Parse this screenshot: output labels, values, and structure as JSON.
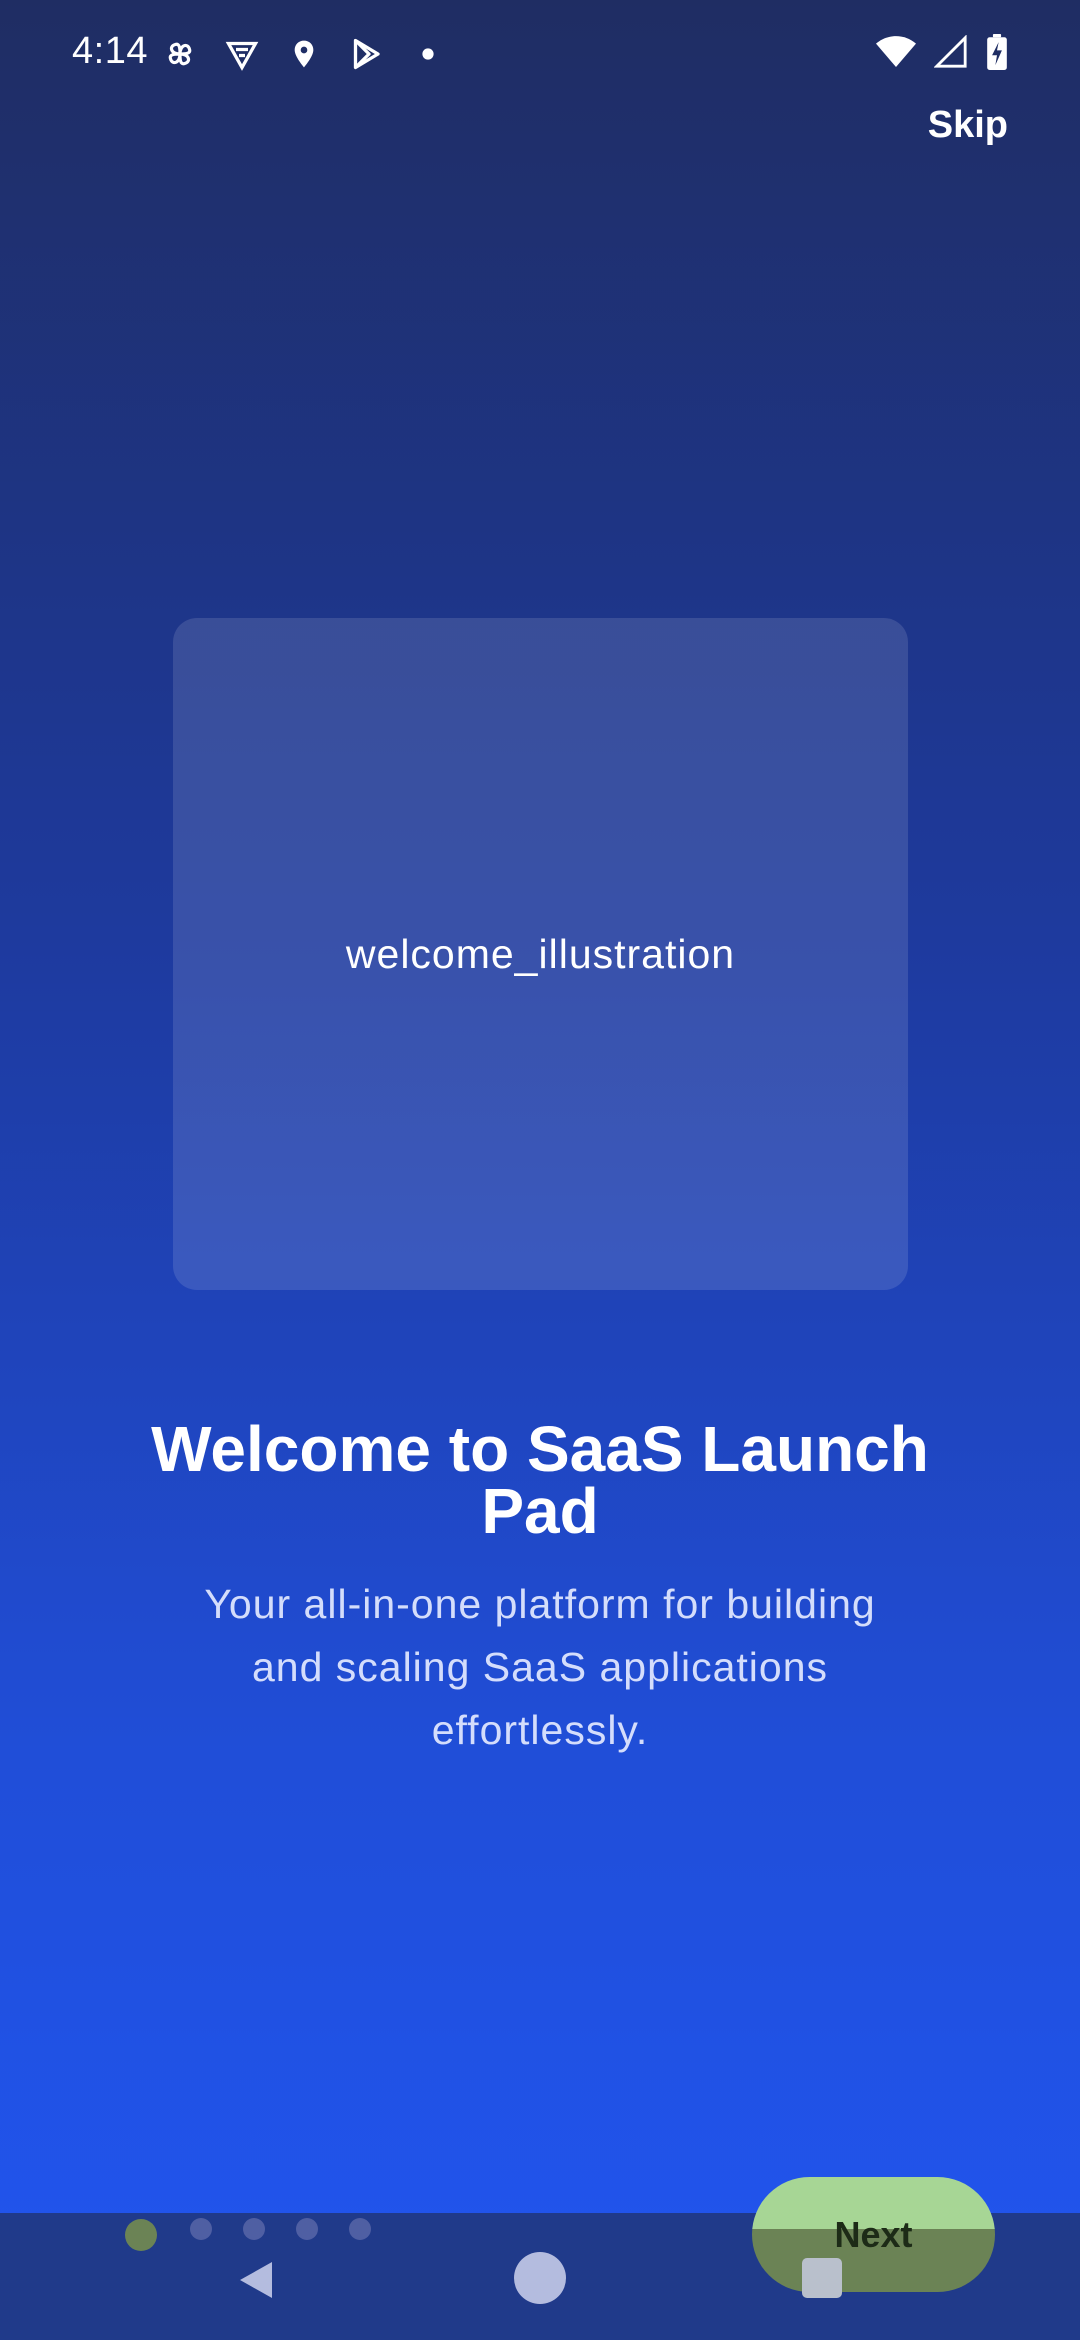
{
  "status_bar": {
    "time": "4:14",
    "left_icons": [
      "pinwheel-icon",
      "shield-icon",
      "location-pin-icon",
      "play-store-icon",
      "notification-dot-icon"
    ],
    "right_icons": [
      "wifi-icon",
      "cell-signal-icon",
      "battery-charging-icon"
    ]
  },
  "header": {
    "skip_label": "Skip"
  },
  "onboarding": {
    "illustration_label": "welcome_illustration",
    "title": "Welcome to SaaS Launch Pad",
    "subtitle": "Your all-in-one platform for building and scaling SaaS applications effortlessly.",
    "page_count": 5,
    "current_page": 1
  },
  "footer": {
    "next_label": "Next"
  },
  "colors": {
    "gradient_top": "#1f2d63",
    "gradient_bottom": "#2155f0",
    "next_button": "#a7d695",
    "active_dot": "#6b8355",
    "inactive_dot": "#4f5fa3"
  }
}
